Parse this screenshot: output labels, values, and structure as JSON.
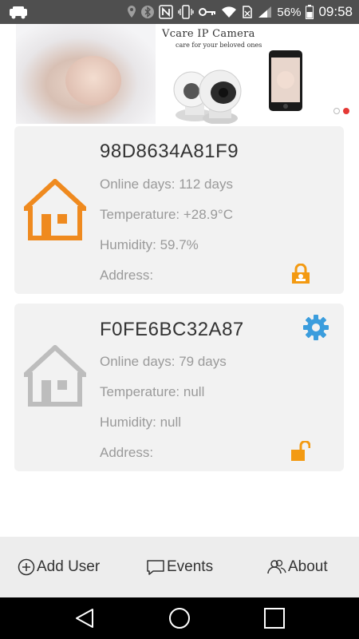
{
  "statusbar": {
    "battery": "56%",
    "time": "09:58"
  },
  "banner": {
    "title": "Vcare IP Camera",
    "subtitle": "care for your beloved ones",
    "colors": {
      "active_dot": "#e53935",
      "inactive_dot": "#ffffff"
    }
  },
  "devices": [
    {
      "id": "98D8634A81F9",
      "online": "Online days: 112 days",
      "temperature": "Temperature: +28.9°C",
      "humidity": "Humidity: 59.7%",
      "address": "Address:",
      "house_icon": "house-icon",
      "house_color": "#ef8a1f",
      "lock_icon": "lock-closed-icon"
    },
    {
      "id": "F0FE6BC32A87",
      "online": "Online days: 79 days",
      "temperature": "Temperature: null",
      "humidity": "Humidity: null",
      "address": "Address:",
      "house_icon": "house-icon",
      "house_color": "#bdbdbd",
      "lock_icon": "lock-open-icon",
      "settings_icon": "gear-icon",
      "settings_color": "#3b9ddd"
    }
  ],
  "bottom_nav": {
    "items": [
      {
        "label": "Add User",
        "icon": "plus-circle-icon"
      },
      {
        "label": "Events",
        "icon": "chat-bubble-icon"
      },
      {
        "label": "About",
        "icon": "users-icon"
      }
    ]
  },
  "system_nav": {
    "buttons": [
      "back-icon",
      "home-icon",
      "recents-icon"
    ]
  }
}
